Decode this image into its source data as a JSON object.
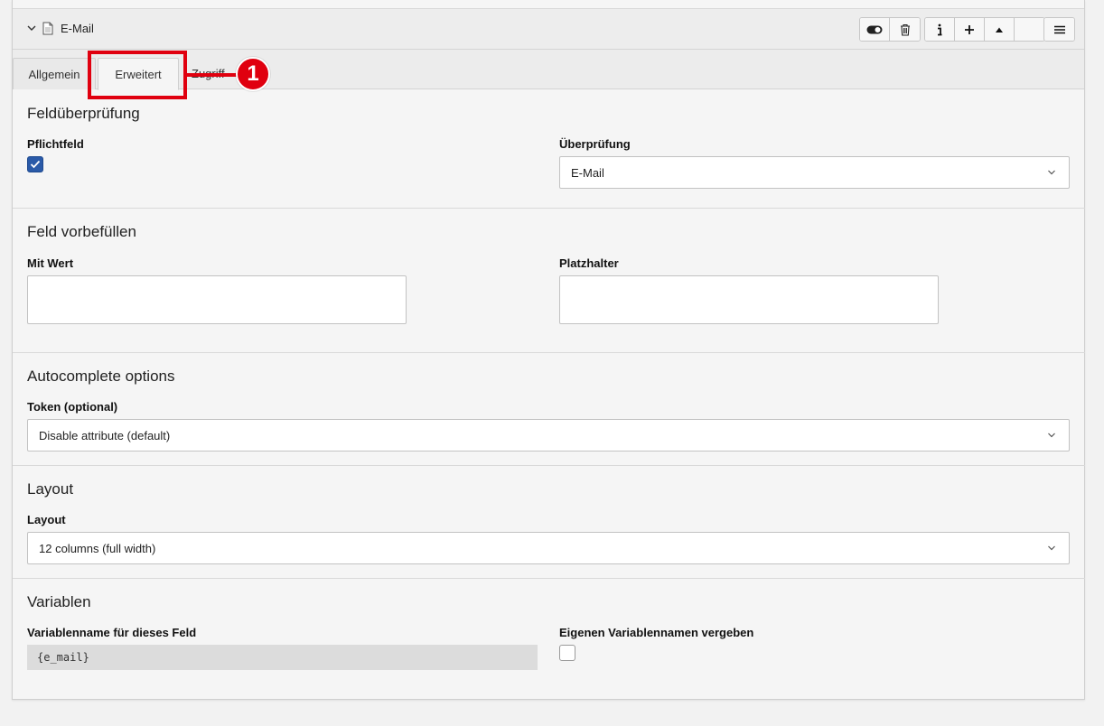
{
  "element": {
    "title": "E-Mail"
  },
  "tabs": [
    {
      "label": "Allgemein"
    },
    {
      "label": "Erweitert"
    },
    {
      "label": "Zugriff"
    }
  ],
  "annotation": {
    "marker": "1",
    "color": "#e0000f"
  },
  "sections": {
    "validation": {
      "heading": "Feldüberprüfung",
      "required_label": "Pflichtfeld",
      "required_checked": true,
      "check_label": "Überprüfung",
      "check_value": "E-Mail"
    },
    "prefill": {
      "heading": "Feld vorbefüllen",
      "value_label": "Mit Wert",
      "value": "",
      "placeholder_label": "Platzhalter",
      "placeholder": ""
    },
    "autocomplete": {
      "heading": "Autocomplete options",
      "token_label": "Token (optional)",
      "token_value": "Disable attribute (default)"
    },
    "layout": {
      "heading": "Layout",
      "layout_label": "Layout",
      "layout_value": "12 columns (full width)"
    },
    "variables": {
      "heading": "Variablen",
      "name_label": "Variablenname für dieses Feld",
      "name_value": "{e_mail}",
      "custom_label": "Eigenen Variablennamen vergeben",
      "custom_checked": false
    }
  },
  "colors": {
    "accent": "#2a5aa8",
    "highlight": "#e0000f"
  }
}
